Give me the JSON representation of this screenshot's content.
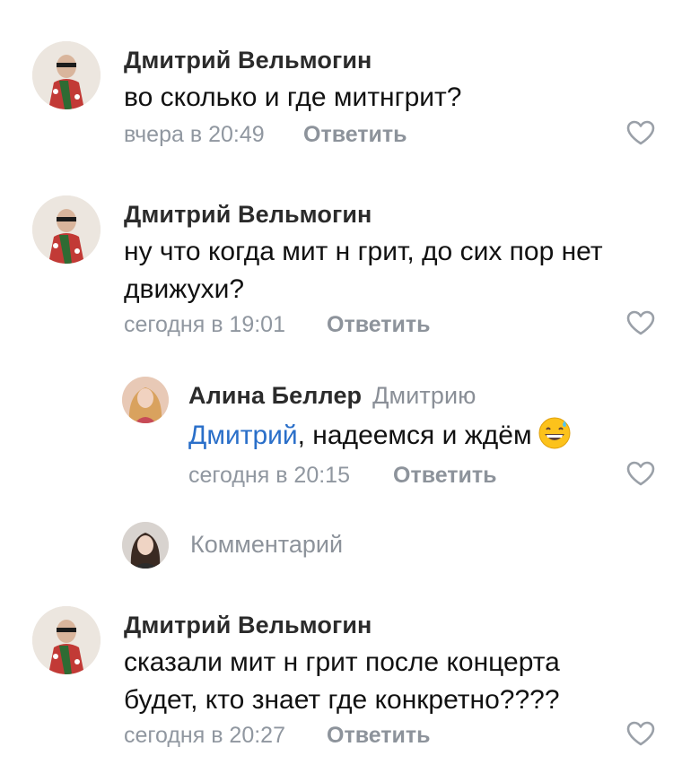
{
  "comments": [
    {
      "author": "Дмитрий Вельмогин",
      "text": "во сколько и где митнгрит?",
      "time": "вчера в 20:49",
      "reply_label": "Ответить"
    },
    {
      "author": "Дмитрий Вельмогин",
      "text": "ну что когда мит н грит, до сих пор нет движухи?",
      "time": "сегодня в 19:01",
      "reply_label": "Ответить",
      "replies": [
        {
          "author": "Алина Беллер",
          "reply_to": "Дмитрию",
          "mention": "Дмитрий",
          "text": ", надеемся и ждём",
          "emoji": "grinning-sweat-emoji",
          "time": "сегодня в 20:15",
          "reply_label": "Ответить"
        }
      ]
    },
    {
      "author": "Дмитрий Вельмогин",
      "text": "сказали мит н грит после концерта будет, кто знает где конкретно????",
      "time": "сегодня в 20:27",
      "reply_label": "Ответить"
    }
  ],
  "reply_input": {
    "placeholder": "Комментарий"
  },
  "icons": {
    "like": "heart-outline-icon"
  },
  "colors": {
    "mention": "#2a6fc9",
    "meta": "#9097a0",
    "name": "#2b2b2b"
  }
}
